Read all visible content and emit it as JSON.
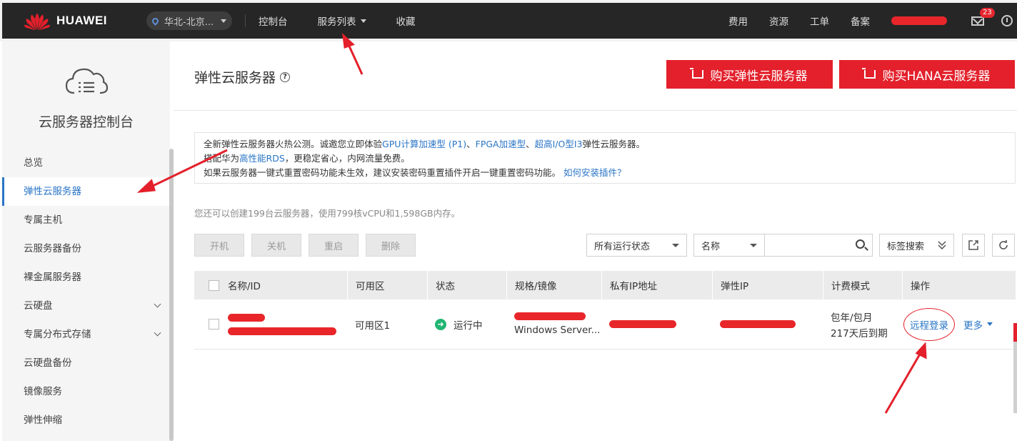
{
  "header": {
    "brand": "HUAWEI",
    "region": "华北-北京...",
    "nav": [
      "控制台",
      "服务列表",
      "收藏"
    ],
    "right_links": [
      "费用",
      "资源",
      "工单",
      "备案"
    ],
    "mail_count": "23"
  },
  "sidebar": {
    "title": "云服务器控制台",
    "items": [
      {
        "label": "总览",
        "expandable": false
      },
      {
        "label": "弹性云服务器",
        "expandable": false,
        "active": true
      },
      {
        "label": "专属主机",
        "expandable": false
      },
      {
        "label": "云服务器备份",
        "expandable": false
      },
      {
        "label": "裸金属服务器",
        "expandable": false
      },
      {
        "label": "云硬盘",
        "expandable": true
      },
      {
        "label": "专属分布式存储",
        "expandable": true
      },
      {
        "label": "云硬盘备份",
        "expandable": false
      },
      {
        "label": "镜像服务",
        "expandable": false
      },
      {
        "label": "弹性伸缩",
        "expandable": false
      }
    ]
  },
  "main": {
    "title": "弹性云服务器",
    "help_glyph": "?",
    "buy_ecs": "购买弹性云服务器",
    "buy_hana": "购买HANA云服务器",
    "notice": {
      "line1_pre": "全新弹性云服务器火热公测。诚邀您立即体验",
      "line1_link1": "GPU计算加速型 (P1)",
      "line1_sep1": "、",
      "line1_link2": "FPGA加速型",
      "line1_sep2": "、",
      "line1_link3": "超高I/O型I3",
      "line1_post": "弹性云服务器。",
      "line2_pre": "搭配华为",
      "line2_link": "高性能RDS",
      "line2_post": "，更稳定省心，内网流量免费。",
      "line3_pre": "如果云服务器一键式重置密码功能未生效，建议安装密码重置插件开启一键重置密码功能。",
      "line3_link": "如何安装插件？"
    },
    "quota": "您还可以创建199台云服务器，使用799核vCPU和1,598GB内存。",
    "actions": [
      "开机",
      "关机",
      "重启",
      "删除"
    ],
    "status_filter": "所有运行状态",
    "field_filter": "名称",
    "search_placeholder": "",
    "tag_search": "标签搜索",
    "columns": [
      "名称/ID",
      "可用区",
      "状态",
      "规格/镜像",
      "私有IP地址",
      "弹性IP",
      "计费模式",
      "操作"
    ],
    "row": {
      "zone": "可用区1",
      "status": "运行中",
      "image": "Windows Server...",
      "billing_line1": "包年/包月",
      "billing_line2": "217天后到期",
      "remote_login": "远程登录",
      "more": "更多"
    }
  },
  "colors": {
    "accent_red": "#e3202b",
    "link_blue": "#2a75c6",
    "topbar": "#262626",
    "running_green": "#22b573"
  }
}
